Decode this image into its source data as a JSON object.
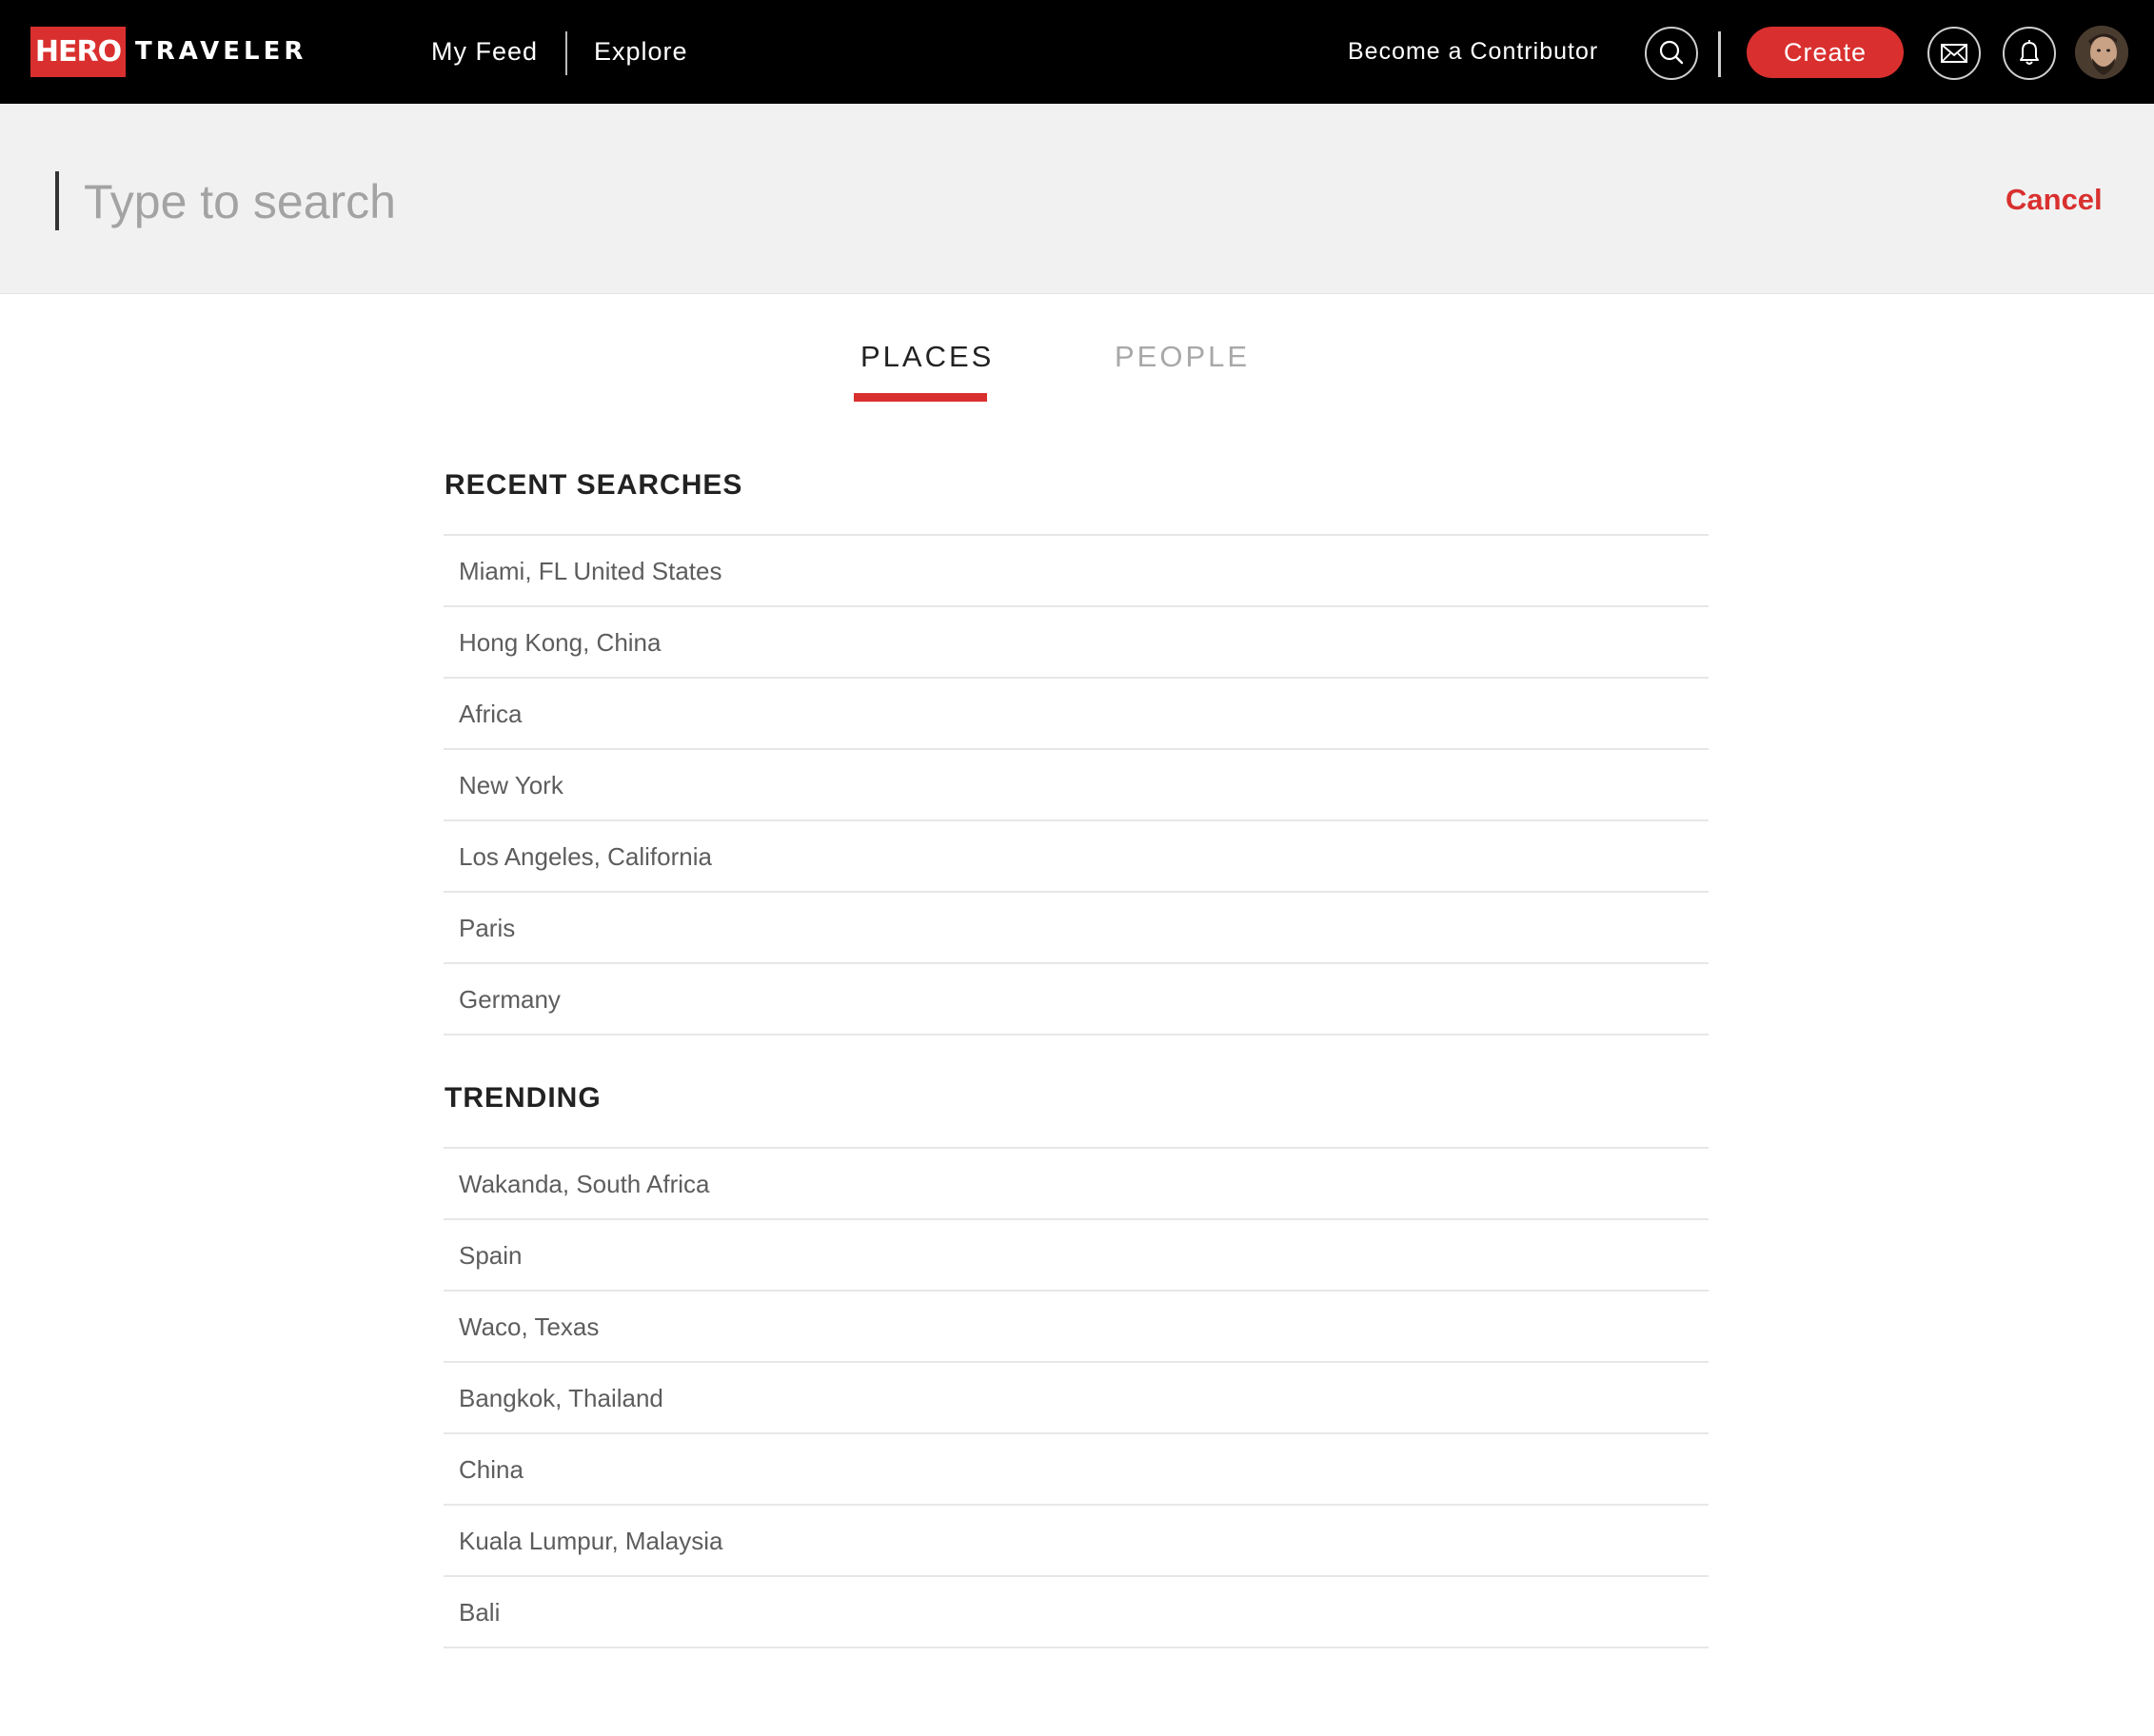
{
  "header": {
    "logo_hero": "HERO",
    "logo_traveler": "TRAVELER",
    "nav": {
      "my_feed": "My Feed",
      "explore": "Explore"
    },
    "become_contributor": "Become a Contributor",
    "create_label": "Create",
    "icons": [
      "search-icon",
      "mail-icon",
      "bell-icon"
    ]
  },
  "search": {
    "placeholder": "Type to search",
    "value": "",
    "cancel_label": "Cancel"
  },
  "tabs": {
    "places": "PLACES",
    "people": "PEOPLE",
    "active": "places"
  },
  "recent": {
    "heading": "RECENT SEARCHES",
    "items": [
      "Miami, FL United States",
      "Hong Kong, China",
      "Africa",
      "New York",
      "Los Angeles, California",
      "Paris",
      "Germany"
    ]
  },
  "trending": {
    "heading": "TRENDING",
    "items": [
      "Wakanda, South Africa",
      "Spain",
      "Waco, Texas",
      "Bangkok, Thailand",
      "China",
      "Kuala Lumpur, Malaysia",
      "Bali"
    ]
  },
  "colors": {
    "accent": "#d9302f",
    "topbar": "#000000",
    "searchbar": "#f1f1f1"
  }
}
